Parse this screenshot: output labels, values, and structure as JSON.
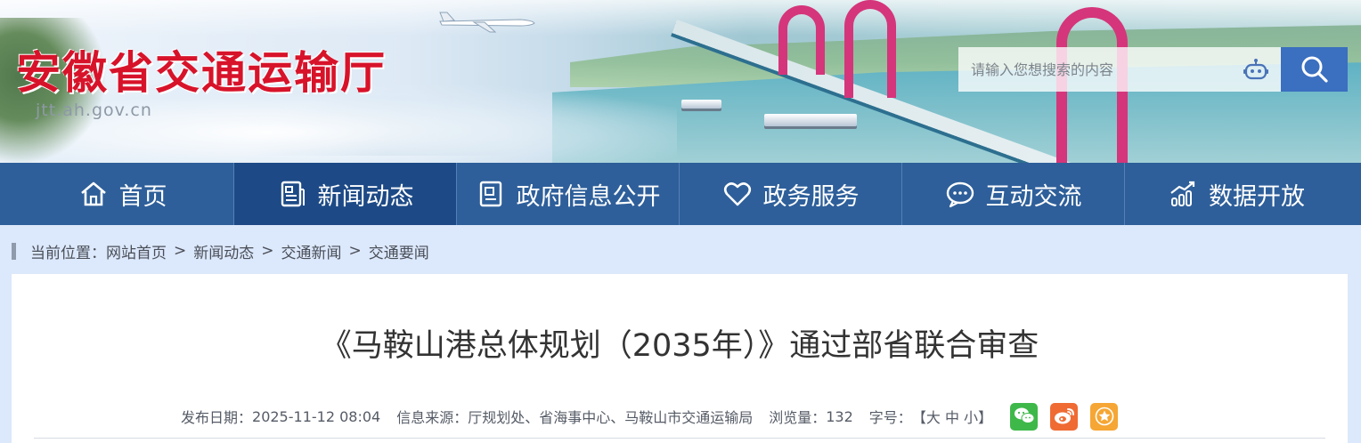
{
  "header": {
    "site_title": "安徽省交通运输厅",
    "site_domain": "jtt.ah.gov.cn",
    "search": {
      "placeholder": "请输入您想搜索的内容",
      "value": ""
    }
  },
  "nav": {
    "items": [
      {
        "label": "首页",
        "icon": "home-icon"
      },
      {
        "label": "新闻动态",
        "icon": "news-icon",
        "active": true
      },
      {
        "label": "政府信息公开",
        "icon": "document-icon"
      },
      {
        "label": "政务服务",
        "icon": "heart-icon"
      },
      {
        "label": "互动交流",
        "icon": "chat-icon"
      },
      {
        "label": "数据开放",
        "icon": "chart-icon"
      }
    ]
  },
  "breadcrumb": {
    "prefix": "当前位置：",
    "items": [
      "网站首页",
      "新闻动态",
      "交通新闻",
      "交通要闻"
    ],
    "separator": ">"
  },
  "article": {
    "title": "《马鞍山港总体规划（2035年）》通过部省联合审查",
    "publish_label": "发布日期：",
    "publish_date": "2025-11-12 08:04",
    "source_label": "信息来源：",
    "source": "厅规划处、省海事中心、马鞍山市交通运输局",
    "views_label": "浏览量：",
    "views": "132",
    "fontsize_label": "字号：",
    "fontsize_open": "【",
    "fontsize_large": "大",
    "fontsize_medium": "中",
    "fontsize_small": "小",
    "fontsize_close": "】"
  },
  "share": {
    "icons": [
      "wechat-icon",
      "weibo-icon",
      "favorite-icon"
    ]
  },
  "colors": {
    "nav_bg": "#2e5f9a",
    "nav_active": "#1d4a86",
    "title_red": "#d7132a",
    "page_bg": "#dce8fb",
    "search_btn": "#3b6fc0"
  }
}
